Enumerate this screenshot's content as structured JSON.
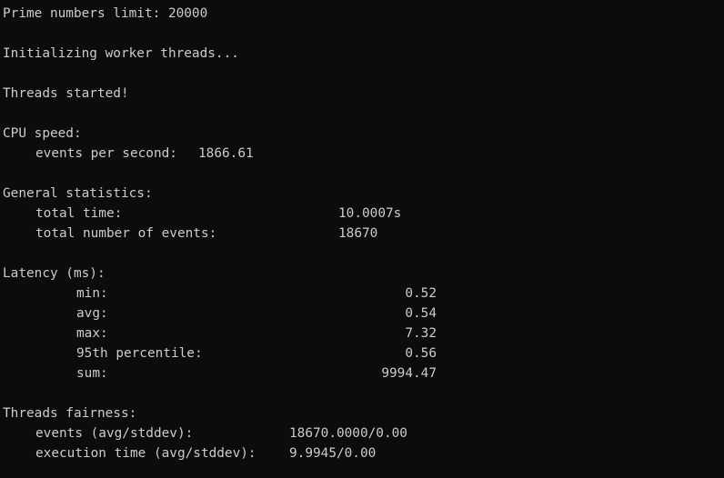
{
  "terminal": {
    "prime_limit": "Prime numbers limit: 20000",
    "init": "Initializing worker threads...",
    "started": "Threads started!",
    "cpu_speed": {
      "header": "CPU speed:",
      "events_label": "events per second:",
      "events_value": "1866.61"
    },
    "general": {
      "header": "General statistics:",
      "total_time_label": "total time:",
      "total_time_value": "10.0007s",
      "total_events_label": "total number of events:",
      "total_events_value": "18670"
    },
    "latency": {
      "header": "Latency (ms):",
      "min_label": "min:",
      "min_value": "0.52",
      "avg_label": "avg:",
      "avg_value": "0.54",
      "max_label": "max:",
      "max_value": "7.32",
      "p95_label": "95th percentile:",
      "p95_value": "0.56",
      "sum_label": "sum:",
      "sum_value": "9994.47"
    },
    "fairness": {
      "header": "Threads fairness:",
      "events_label": "events (avg/stddev):",
      "events_value": "18670.0000/0.00",
      "exec_label": "execution time (avg/stddev):",
      "exec_value": "9.9945/0.00"
    }
  }
}
